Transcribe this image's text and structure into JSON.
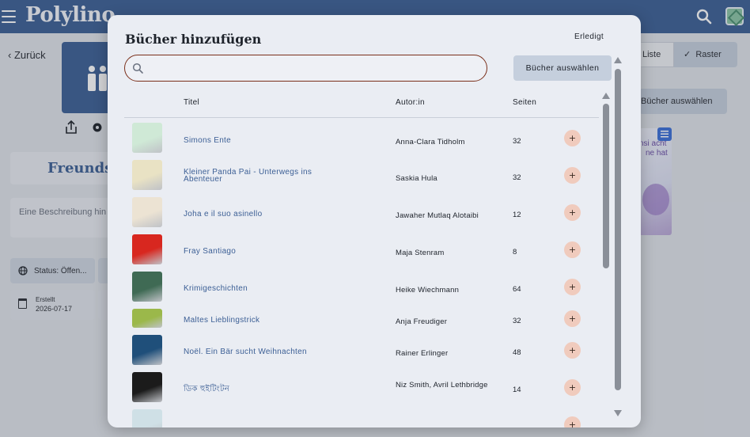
{
  "app": {
    "logo": "Polylino",
    "back_label": "Zurück",
    "group_title": "Freunds",
    "description_placeholder": "Eine Beschreibung hin",
    "status_label": "Status: Öffen...",
    "created_label": "Erstellt",
    "created_value": "2026-07-17",
    "view_list_label": "Liste",
    "view_grid_label": "Raster",
    "select_books_label": "Bücher auswählen",
    "bg_book_line1": "nsi acht",
    "bg_book_line2": "ne hat"
  },
  "modal": {
    "title": "Bücher hinzufügen",
    "done_label": "Erledigt",
    "search": {
      "value": "",
      "placeholder": ""
    },
    "select_button_label": "Bücher auswählen",
    "columns": {
      "title": "Titel",
      "author": "Autor:in",
      "pages": "Seiten"
    },
    "add_label": "+",
    "books": [
      {
        "title": "Simons Ente",
        "author": "Anna-Clara Tidholm",
        "pages": "32",
        "cover_color": "#cfe9d6"
      },
      {
        "title": "Kleiner Panda Pai - Unterwegs ins Abenteuer",
        "author": "Saskia Hula",
        "pages": "32",
        "cover_color": "#e9e2c4"
      },
      {
        "title": "Joha e il suo asinello",
        "author": "Jawaher Mutlaq Alotaibi",
        "pages": "12",
        "cover_color": "#ece3d3"
      },
      {
        "title": "Fray Santiago",
        "author": "Maja Stenram",
        "pages": "8",
        "cover_color": "#d8271f"
      },
      {
        "title": "Krimigeschichten",
        "author": "Heike Wiechmann",
        "pages": "64",
        "cover_color": "#3f6a54"
      },
      {
        "title": "Maltes Lieblingstrick",
        "author": "Anja Freudiger",
        "pages": "32",
        "cover_color": "#9bb84a"
      },
      {
        "title": "Noël. Ein Bär sucht Weihnachten",
        "author": "Rainer Erlinger",
        "pages": "48",
        "cover_color": "#1f4f7a"
      },
      {
        "title": "ডিক হুইটিংটন",
        "author": "Niz Smith, Avril Lethbridge",
        "pages": "14",
        "cover_color": "#1b1b1b"
      },
      {
        "title": "",
        "author": "",
        "pages": "",
        "cover_color": "#cfe0e6"
      }
    ]
  }
}
